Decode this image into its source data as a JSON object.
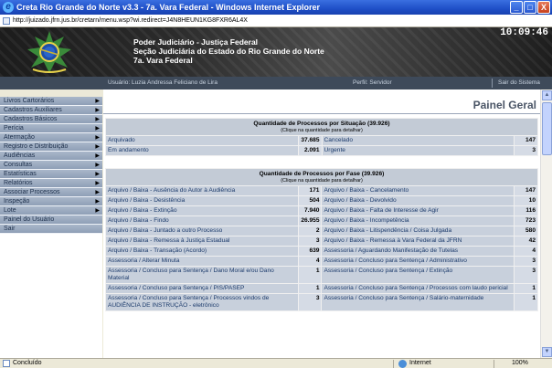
{
  "window": {
    "title": "Creta Rio Grande do Norte v3.3 - 7a. Vara Federal - Windows Internet Explorer",
    "address": "http://juizado.jfrn.jus.br/cretarn/menu.wsp?wi.redirect=J4N8HEUN1KG8FXR6AL4X",
    "min_label": "_",
    "max_label": "□",
    "close_label": "X"
  },
  "banner": {
    "line1": "Poder Judiciário - Justiça Federal",
    "line2": "Seção Judiciária do Estado do Rio Grande do Norte",
    "line3": "7a. Vara Federal",
    "clock": "10:09:46"
  },
  "userbar": {
    "user": "Usuário: Luzia Andressa Feliciano de Lira",
    "perfil": "Perfil: Servidor",
    "sair": "Sair do Sistema"
  },
  "sidebar": {
    "items": [
      {
        "label": "Livros Cartorários",
        "arrow": "▶"
      },
      {
        "label": "Cadastros Auxiliares",
        "arrow": "▶"
      },
      {
        "label": "Cadastros Básicos",
        "arrow": "▶"
      },
      {
        "label": "Perícia",
        "arrow": "▶"
      },
      {
        "label": "Atermação",
        "arrow": "▶"
      },
      {
        "label": "Registro e Distribuição",
        "arrow": "▶"
      },
      {
        "label": "Audiências",
        "arrow": "▶"
      },
      {
        "label": "Consultas",
        "arrow": "▶"
      },
      {
        "label": "Estatísticas",
        "arrow": "▶"
      },
      {
        "label": "Relatórios",
        "arrow": "▶"
      },
      {
        "label": "Associar Processos",
        "arrow": "▶"
      },
      {
        "label": "Inspeção",
        "arrow": "▶"
      },
      {
        "label": "Lote",
        "arrow": "▶"
      },
      {
        "label": "Painel do Usuário",
        "arrow": ""
      },
      {
        "label": "Sair",
        "arrow": ""
      }
    ]
  },
  "main": {
    "title": "Painel Geral",
    "situacao": {
      "header": "Quantidade de Processos por Situação (39.926)",
      "sub": "(Clique na quantidade para detalhar)",
      "rows": [
        [
          "Arquivado",
          "37.685",
          "Cancelado",
          "147"
        ],
        [
          "Em andamento",
          "2.091",
          "Urgente",
          "3"
        ]
      ]
    },
    "fase": {
      "header": "Quantidade de Processos por Fase (39.926)",
      "sub": "(Clique na quantidade para detalhar)",
      "rows": [
        [
          "Arquivo / Baixa - Ausência do Autor à Audiência",
          "171",
          "Arquivo / Baixa - Cancelamento",
          "147"
        ],
        [
          "Arquivo / Baixa - Desistência",
          "504",
          "Arquivo / Baixa - Devolvido",
          "10"
        ],
        [
          "Arquivo / Baixa - Extinção",
          "7.940",
          "Arquivo / Baixa - Falta de Interesse de Agir",
          "116"
        ],
        [
          "Arquivo / Baixa - Findo",
          "26.955",
          "Arquivo / Baixa - Incompetência",
          "723"
        ],
        [
          "Arquivo / Baixa - Juntado a outro Processo",
          "2",
          "Arquivo / Baixa - Litispendência / Coisa Julgada",
          "580"
        ],
        [
          "Arquivo / Baixa - Remessa à Justiça Estadual",
          "3",
          "Arquivo / Baixa - Remessa à Vara Federal da JFRN",
          "42"
        ],
        [
          "Arquivo / Baixa - Transação (Acordo)",
          "639",
          "Assessoria / Aguardando Manifestação de Tutelas",
          "4"
        ],
        [
          "Assessoria / Alterar Minuta",
          "4",
          "Assessoria / Concluso para Sentença / Administrativo",
          "3"
        ],
        [
          "Assessoria / Concluso para Sentença / Dano Moral e/ou Dano Material",
          "1",
          "Assessoria / Concluso para Sentença / Extinção",
          "3"
        ],
        [
          "Assessoria / Concluso para Sentença / PIS/PASEP",
          "1",
          "Assessoria / Concluso para Sentença / Processos com laudo pericial",
          "1"
        ],
        [
          "Assessoria / Concluso para Sentença / Processos vindos de AUDIÊNCIA DE INSTRUÇÃO - eletrônico",
          "3",
          "Assessoria / Concluso para Sentença / Salário-maternidade",
          "1"
        ]
      ]
    }
  },
  "status": {
    "left": "Concluído",
    "zone": "Internet",
    "zoom": "100%"
  }
}
